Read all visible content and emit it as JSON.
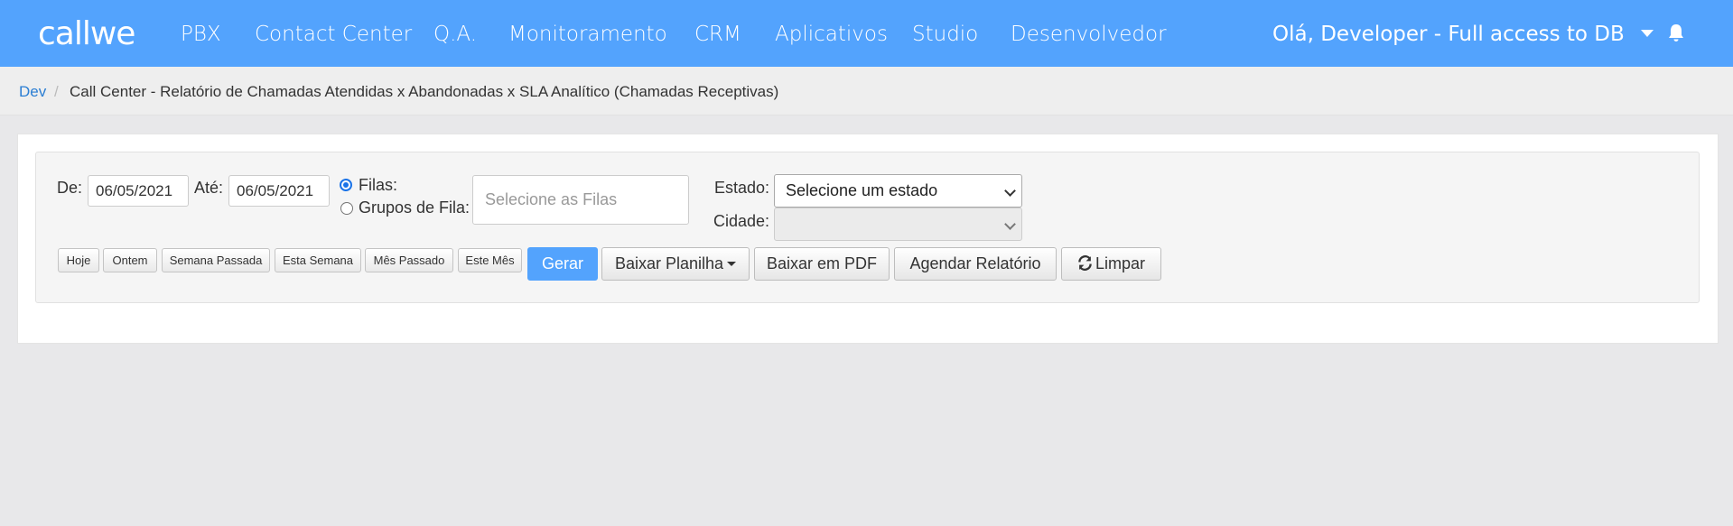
{
  "navbar": {
    "logo": "callwe",
    "items": [
      "PBX",
      "Contact Center",
      "Q.A.",
      "Monitoramento",
      "CRM",
      "Aplicativos",
      "Studio",
      "Desenvolvedor"
    ],
    "user_menu": "Olá, Developer - Full access to DB",
    "bell_icon": "bell-icon"
  },
  "breadcrumb": {
    "root": "Dev",
    "separator": "/",
    "current": "Call Center - Relatório de Chamadas Atendidas x Abandonadas x SLA Analítico (Chamadas Receptivas)"
  },
  "filters": {
    "from_label": "De:",
    "from_value": "06/05/2021",
    "to_label": "Até:",
    "to_value": "06/05/2021",
    "radio_filas": "Filas:",
    "radio_grupos": "Grupos de Fila:",
    "filas_placeholder": "Selecione as Filas",
    "estado_label": "Estado:",
    "estado_value": "Selecione um estado",
    "cidade_label": "Cidade:",
    "cidade_value": ""
  },
  "quick_ranges": [
    "Hoje",
    "Ontem",
    "Semana Passada",
    "Esta Semana",
    "Mês Passado",
    "Este Mês"
  ],
  "actions": {
    "gerar": "Gerar",
    "baixar_planilha": "Baixar Planilha",
    "baixar_pdf": "Baixar em PDF",
    "agendar": "Agendar Relatório",
    "limpar": "Limpar"
  },
  "colors": {
    "brand": "#53a3fd",
    "link": "#2b7ed3"
  }
}
